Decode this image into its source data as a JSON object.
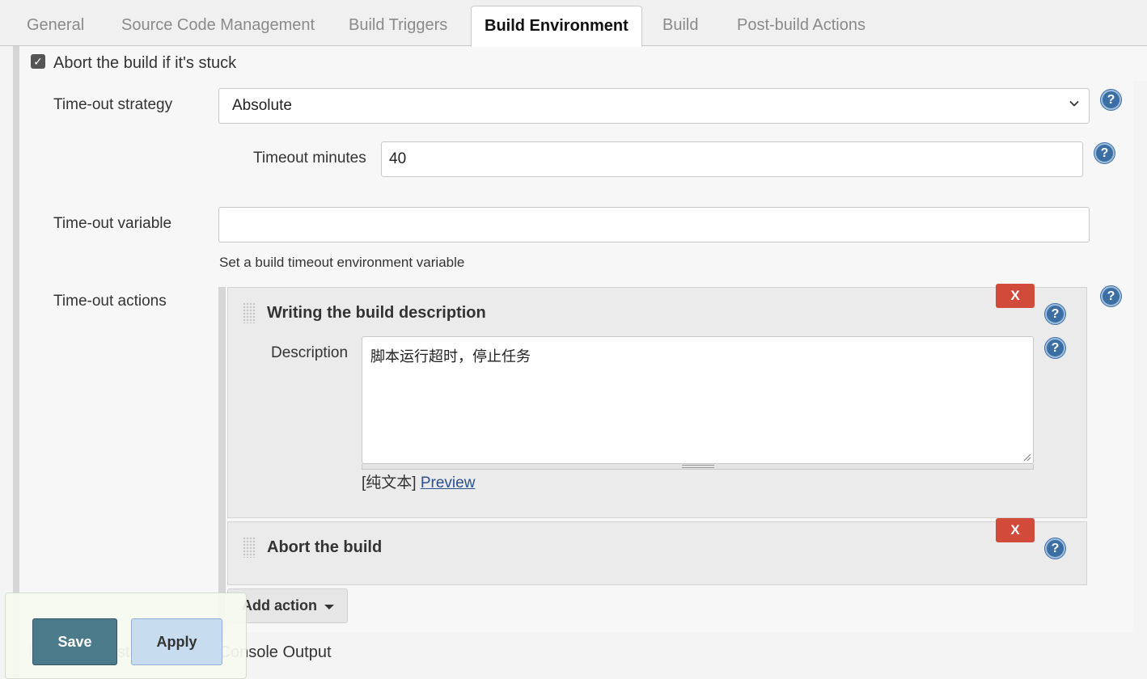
{
  "tabs": [
    {
      "label": "General"
    },
    {
      "label": "Source Code Management"
    },
    {
      "label": "Build Triggers"
    },
    {
      "label": "Build Environment",
      "active": true
    },
    {
      "label": "Build"
    },
    {
      "label": "Post-build Actions"
    }
  ],
  "abort": {
    "checkbox_checked": true,
    "label": "Abort the build if it's stuck"
  },
  "timeout_strategy": {
    "label": "Time-out strategy",
    "value": "Absolute"
  },
  "timeout_minutes": {
    "label": "Timeout minutes",
    "value": "40"
  },
  "timeout_variable": {
    "label": "Time-out variable",
    "value": "",
    "hint": "Set a build timeout environment variable"
  },
  "timeout_actions": {
    "label": "Time-out actions",
    "remove_label": "X",
    "cards": [
      {
        "title": "Writing the build description",
        "description_label": "Description",
        "description_value": "脚本运行超时，停止任务",
        "format_label": "[纯文本]",
        "preview_label": "Preview"
      },
      {
        "title": "Abort the build"
      }
    ],
    "add_action_label": "Add action"
  },
  "bottom_option": {
    "label": "Add timestamps to the Console Output",
    "visible_text": "Console Output"
  },
  "buttons": {
    "save": "Save",
    "apply": "Apply"
  },
  "help_glyph": "?",
  "icons": [
    "checkbox-icon",
    "help-icon",
    "chevron-down-icon",
    "drag-handle-icon",
    "remove-icon",
    "caret-down-icon",
    "resize-grip-icon"
  ],
  "colors": {
    "remove_button": "#d24a3a",
    "help_icon": "#3b6ea3",
    "save_button": "#4b7a8a",
    "apply_button": "#c7dcef",
    "link": "#2b4f8f"
  }
}
